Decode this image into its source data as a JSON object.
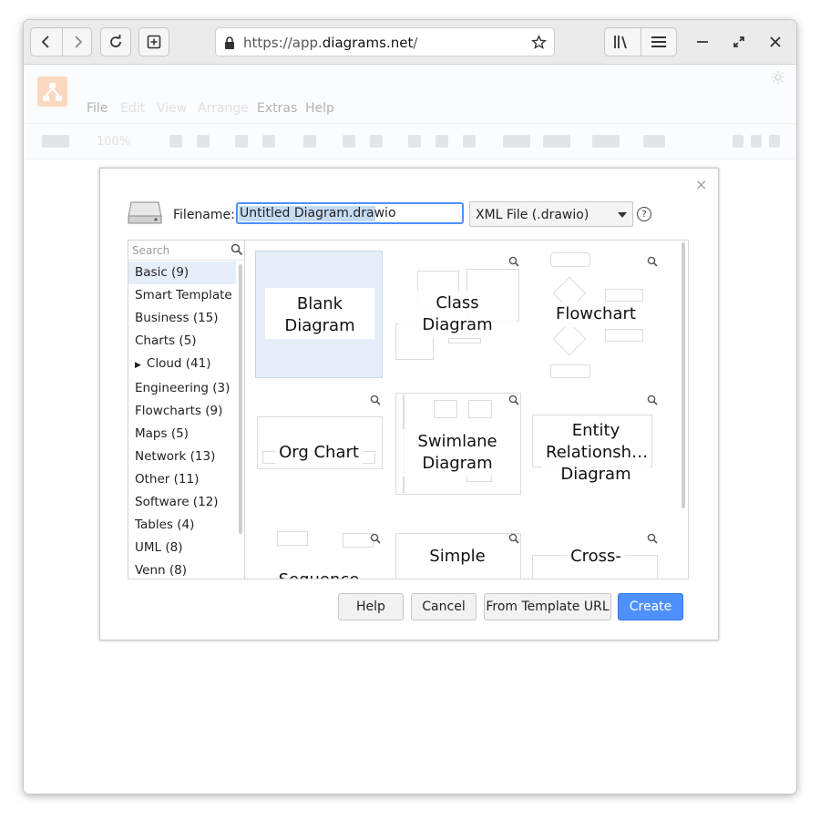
{
  "browser": {
    "url_prefix": "https://app.",
    "url_host": "diagrams.net",
    "url_suffix": "/"
  },
  "app": {
    "menu": [
      "File",
      "Edit",
      "View",
      "Arrange",
      "Extras",
      "Help"
    ],
    "zoom": "100%"
  },
  "dialog": {
    "filename_label": "Filename:",
    "filename_value": "Untitled Diagram.drawio",
    "format": "XML File (.drawio)",
    "help_icon": "?",
    "close": "×",
    "search_placeholder": "Search",
    "categories": [
      "Basic (9)",
      "Smart Template",
      "Business (15)",
      "Charts (5)",
      "Cloud (41)",
      "Engineering (3)",
      "Flowcharts (9)",
      "Maps (5)",
      "Network (13)",
      "Other (11)",
      "Software (12)",
      "Tables (4)",
      "UML (8)",
      "Venn (8)"
    ],
    "cloud_expander": "▶",
    "templates": [
      "Blank Diagram",
      "Class Diagram",
      "Flowchart",
      "Org Chart",
      "Swimlane Diagram",
      "Entity Relationsh… Diagram",
      "Sequence",
      "Simple",
      "Cross-"
    ],
    "buttons": {
      "help": "Help",
      "cancel": "Cancel",
      "from_template_url": "From Template URL",
      "create": "Create"
    }
  },
  "colors": {
    "accent": "#4d90fe",
    "selection": "#e6eef9"
  }
}
